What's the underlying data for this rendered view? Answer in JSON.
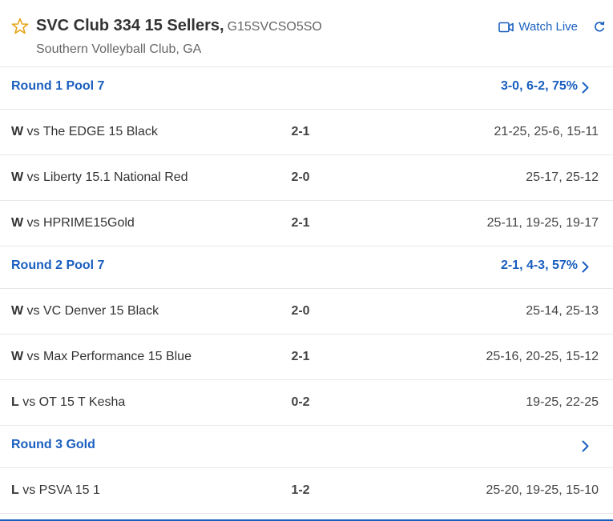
{
  "header": {
    "team_name": "SVC Club 334 15 Sellers,",
    "team_code": "G15SVCSO5SO",
    "club": "Southern Volleyball Club, GA",
    "watch_live": "Watch Live"
  },
  "rounds": [
    {
      "title": "Round 1 Pool 7",
      "summary": "3-0, 6-2, 75%",
      "matches": [
        {
          "result": "W",
          "opponent": " vs The EDGE 15 Black",
          "score": "2-1",
          "sets": "21-25, 25-6, 15-11"
        },
        {
          "result": "W",
          "opponent": " vs Liberty 15.1 National Red",
          "score": "2-0",
          "sets": "25-17, 25-12"
        },
        {
          "result": "W",
          "opponent": " vs HPRIME15Gold",
          "score": "2-1",
          "sets": "25-11, 19-25, 19-17"
        }
      ]
    },
    {
      "title": "Round 2 Pool 7",
      "summary": "2-1, 4-3, 57%",
      "matches": [
        {
          "result": "W",
          "opponent": " vs VC Denver 15 Black",
          "score": "2-0",
          "sets": "25-14, 25-13"
        },
        {
          "result": "W",
          "opponent": " vs Max Performance 15 Blue",
          "score": "2-1",
          "sets": "25-16, 20-25, 15-12"
        },
        {
          "result": "L",
          "opponent": " vs OT 15 T Kesha",
          "score": "0-2",
          "sets": "19-25, 22-25"
        }
      ]
    },
    {
      "title": "Round 3 Gold",
      "summary": "",
      "matches": [
        {
          "result": "L",
          "opponent": " vs PSVA 15 1",
          "score": "1-2",
          "sets": "25-20, 19-25, 15-10"
        }
      ]
    }
  ],
  "colors": {
    "accent": "#1a5fbf",
    "star": "#e8a317",
    "divider": "#e8e8e8"
  }
}
